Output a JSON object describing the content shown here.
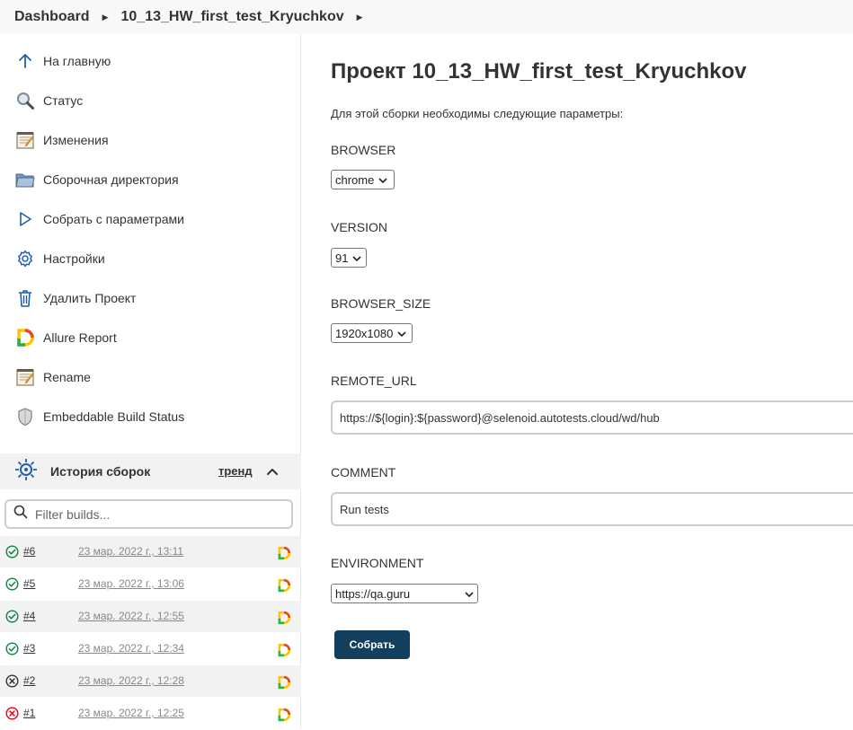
{
  "breadcrumb": {
    "items": [
      "Dashboard",
      "10_13_HW_first_test_Kryuchkov"
    ]
  },
  "sidebar": {
    "tasks": [
      {
        "label": "На главную",
        "icon": "arrow-up-icon"
      },
      {
        "label": "Статус",
        "icon": "search-icon"
      },
      {
        "label": "Изменения",
        "icon": "notepad-icon"
      },
      {
        "label": "Сборочная директория",
        "icon": "folder-icon"
      },
      {
        "label": "Собрать с параметрами",
        "icon": "play-icon"
      },
      {
        "label": "Настройки",
        "icon": "gear-icon"
      },
      {
        "label": "Удалить Проект",
        "icon": "trash-icon"
      },
      {
        "label": "Allure Report",
        "icon": "allure-icon"
      },
      {
        "label": "Rename",
        "icon": "notepad-icon"
      },
      {
        "label": "Embeddable Build Status",
        "icon": "shield-icon"
      }
    ]
  },
  "history": {
    "title": "История сборок",
    "trend": "тренд",
    "filter_placeholder": "Filter builds...",
    "builds": [
      {
        "number": "#6",
        "date": "23 мар. 2022 г., 13:11",
        "status": "success"
      },
      {
        "number": "#5",
        "date": "23 мар. 2022 г., 13:06",
        "status": "success"
      },
      {
        "number": "#4",
        "date": "23 мар. 2022 г., 12:55",
        "status": "success"
      },
      {
        "number": "#3",
        "date": "23 мар. 2022 г., 12:34",
        "status": "success"
      },
      {
        "number": "#2",
        "date": "23 мар. 2022 г., 12:28",
        "status": "aborted"
      },
      {
        "number": "#1",
        "date": "23 мар. 2022 г., 12:25",
        "status": "failed"
      }
    ]
  },
  "main": {
    "title": "Проект 10_13_HW_first_test_Kryuchkov",
    "description": "Для этой сборки необходимы следующие параметры:",
    "params": {
      "browser": {
        "label": "BROWSER",
        "value": "chrome"
      },
      "version": {
        "label": "VERSION",
        "value": "91"
      },
      "browser_size": {
        "label": "BROWSER_SIZE",
        "value": "1920x1080"
      },
      "remote_url": {
        "label": "REMOTE_URL",
        "value": "https://${login}:${password}@selenoid.autotests.cloud/wd/hub"
      },
      "comment": {
        "label": "COMMENT",
        "value": "Run tests"
      },
      "environment": {
        "label": "ENVIRONMENT",
        "value": "https://qa.guru"
      }
    },
    "build_button": "Собрать"
  },
  "colors": {
    "success": "#138347",
    "failed": "#e6001f",
    "aborted": "#333333",
    "button": "#133f5e",
    "link_blue": "#1e5fb3"
  }
}
